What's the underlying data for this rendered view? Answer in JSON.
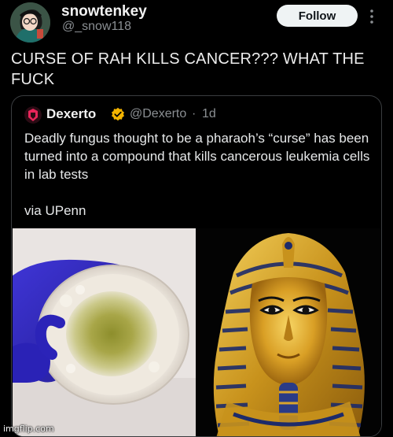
{
  "post": {
    "author": {
      "name": "snowtenkey",
      "handle": "@_snow118"
    },
    "follow_label": "Follow",
    "text": "CURSE OF RAH KILLS CANCER??? WHAT THE FUCK"
  },
  "quote": {
    "author": {
      "name": "Dexerto",
      "handle": "@Dexerto",
      "time": "1d",
      "separator": "·"
    },
    "text": "Deadly fungus thought to be a pharaoh’s “curse” has been turned into a compound that kills cancerous leukemia cells in lab tests",
    "via": "via UPenn",
    "media": [
      {
        "icon": "petri-dish-photo"
      },
      {
        "icon": "pharaoh-mask-photo"
      }
    ]
  },
  "watermark": "imgflip.com",
  "colors": {
    "background": "#000000",
    "follow_button": "#eff3f4",
    "verified_badge": "#f4b400",
    "secondary_text": "#8b8f93",
    "border": "#3a3d40"
  }
}
